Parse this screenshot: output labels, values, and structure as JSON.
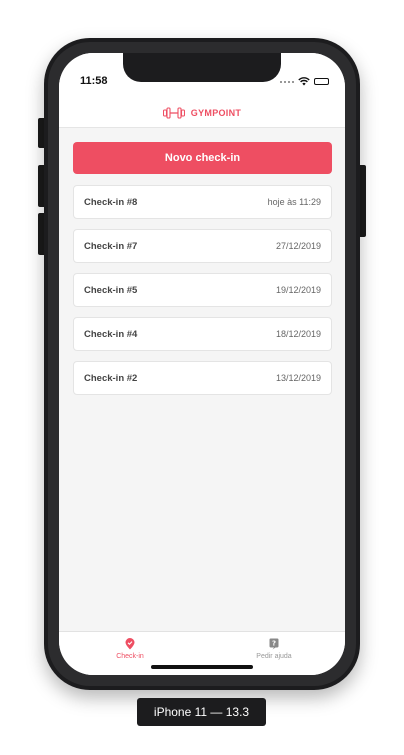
{
  "status_bar": {
    "time": "11:58"
  },
  "header": {
    "brand": "GYMPOINT"
  },
  "main": {
    "new_checkin_label": "Novo check-in",
    "checkins": [
      {
        "title": "Check-in #8",
        "date": "hoje às 11:29"
      },
      {
        "title": "Check-in #7",
        "date": "27/12/2019"
      },
      {
        "title": "Check-in #5",
        "date": "19/12/2019"
      },
      {
        "title": "Check-in #4",
        "date": "18/12/2019"
      },
      {
        "title": "Check-in #2",
        "date": "13/12/2019"
      }
    ]
  },
  "tabbar": {
    "items": [
      {
        "label": "Check-in",
        "icon": "location-pin-icon",
        "active": true
      },
      {
        "label": "Pedir ajuda",
        "icon": "help-icon",
        "active": false
      }
    ]
  },
  "device": {
    "label": "iPhone 11 — 13.3"
  },
  "colors": {
    "accent": "#ee4e62",
    "background": "#f5f5f5"
  }
}
